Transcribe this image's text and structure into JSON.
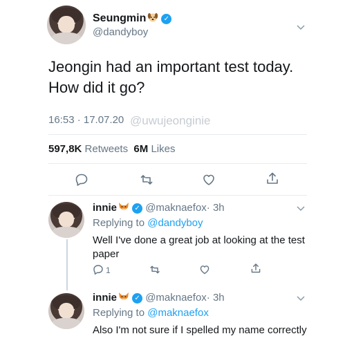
{
  "main_tweet": {
    "author_name": "Seungmin",
    "author_handle": "@dandyboy",
    "text": "Jeongin had an important test today. How did it go?",
    "timestamp": "16:53 · 17.07.20",
    "watermark": "@uwujeonginie",
    "retweets_count": "597,8K",
    "retweets_label": "Retweets",
    "likes_count": "6M",
    "likes_label": "Likes"
  },
  "replies": [
    {
      "author_name": "innie",
      "author_handle": "@maknaefox",
      "time": "· 3h",
      "replying_prefix": "Replying to",
      "replying_to": "@dandyboy",
      "text": "Well I've done a great job at looking at the test paper",
      "reply_count": "1"
    },
    {
      "author_name": "innie",
      "author_handle": "@maknaefox",
      "time": "· 3h",
      "replying_prefix": "Replying to",
      "replying_to": "@maknaefox",
      "text": "Also I'm not sure if I spelled my name correctly"
    }
  ],
  "colors": {
    "accent": "#1da1f2",
    "secondary_text": "#657786",
    "divider": "#e6ecf0"
  },
  "icons": [
    "dog-emoji-icon",
    "fox-emoji-icon",
    "verified-icon",
    "chevron-down-icon",
    "reply-icon",
    "retweet-icon",
    "like-icon",
    "share-icon"
  ]
}
